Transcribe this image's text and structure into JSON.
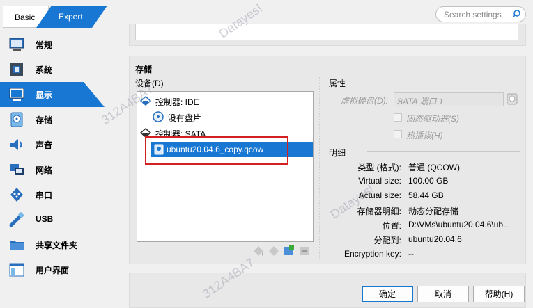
{
  "mode_toggle": {
    "basic": "Basic",
    "expert": "Expert"
  },
  "search": {
    "placeholder": "Search settings"
  },
  "sidebar": {
    "items": [
      {
        "label": "常规",
        "icon": "general-monitor-icon"
      },
      {
        "label": "系统",
        "icon": "system-chip-icon"
      },
      {
        "label": "显示",
        "icon": "display-monitor-icon",
        "active": true
      },
      {
        "label": "存储",
        "icon": "storage-disk-icon"
      },
      {
        "label": "声音",
        "icon": "audio-speaker-icon"
      },
      {
        "label": "网络",
        "icon": "network-icon"
      },
      {
        "label": "串口",
        "icon": "serial-port-icon"
      },
      {
        "label": "USB",
        "icon": "usb-icon"
      },
      {
        "label": "共享文件夹",
        "icon": "shared-folder-icon"
      },
      {
        "label": "用户界面",
        "icon": "user-interface-icon"
      }
    ]
  },
  "storage": {
    "title": "存储",
    "devices_label": "设备(D)",
    "tree": [
      {
        "label": "控制器: IDE",
        "type": "controller"
      },
      {
        "label": "没有盘片",
        "type": "optical"
      },
      {
        "label": "控制器: SATA",
        "type": "controller"
      },
      {
        "label": "ubuntu20.04.6_copy.qcow",
        "type": "disk",
        "selected": true
      }
    ],
    "attributes": {
      "label": "属性",
      "hard_disk_label": "虚拟硬盘(D):",
      "hard_disk_value": "SATA 端口 1",
      "solid_state": "固态驱动器(S)",
      "hot_pluggable": "热插拔(H)"
    },
    "details": {
      "label": "明细",
      "rows": [
        {
          "key": "类型 (格式):",
          "value": "普通 (QCOW)"
        },
        {
          "key": "Virtual size:",
          "value": "100.00 GB"
        },
        {
          "key": "Actual size:",
          "value": "58.44 GB"
        },
        {
          "key": "存储器明细:",
          "value": "动态分配存储"
        },
        {
          "key": "位置:",
          "value": "D:\\VMs\\ubuntu20.04.6\\ub..."
        },
        {
          "key": "分配到:",
          "value": "ubuntu20.04.6"
        },
        {
          "key": "Encryption key:",
          "value": "--"
        }
      ]
    }
  },
  "buttons": {
    "ok": "确定",
    "cancel": "取消",
    "help": "帮助(H)"
  },
  "watermarks": [
    "Datayes!",
    "312A4BA7",
    "Datayes!",
    "312A4BA7"
  ],
  "colors": {
    "accent": "#1777d2",
    "highlight_box": "#d42020"
  }
}
